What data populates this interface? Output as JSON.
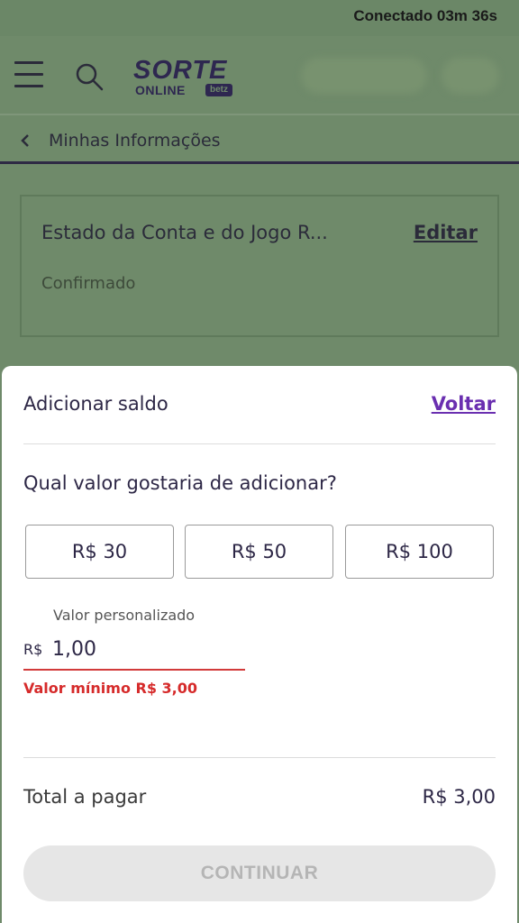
{
  "status_bar": {
    "connection_text": "Conectado 03m 36s"
  },
  "header": {
    "logo_top": "SORTE",
    "logo_online": "ONLINE",
    "logo_badge": "betz"
  },
  "breadcrumb": {
    "label": "Minhas Informações"
  },
  "account_card": {
    "title": "Estado da Conta e do Jogo R...",
    "edit_label": "Editar",
    "status": "Confirmado"
  },
  "sheet": {
    "title": "Adicionar saldo",
    "back_label": "Voltar",
    "question": "Qual valor gostaria de adicionar?",
    "amount_options": [
      "R$ 30",
      "R$ 50",
      "R$ 100"
    ],
    "custom_label": "Valor personalizado",
    "currency_prefix": "R$",
    "custom_value": "1,00",
    "error": "Valor mínimo R$ 3,00",
    "total_label": "Total a pagar",
    "total_value": "R$ 3,00",
    "continue_label": "CONTINUAR"
  },
  "colors": {
    "overlay_bg": "#6f8a6a",
    "brand_dark": "#2e2750",
    "link_purple": "#6a2fb0",
    "error_red": "#d62b2b",
    "disabled_btn": "#e6e6e6"
  }
}
